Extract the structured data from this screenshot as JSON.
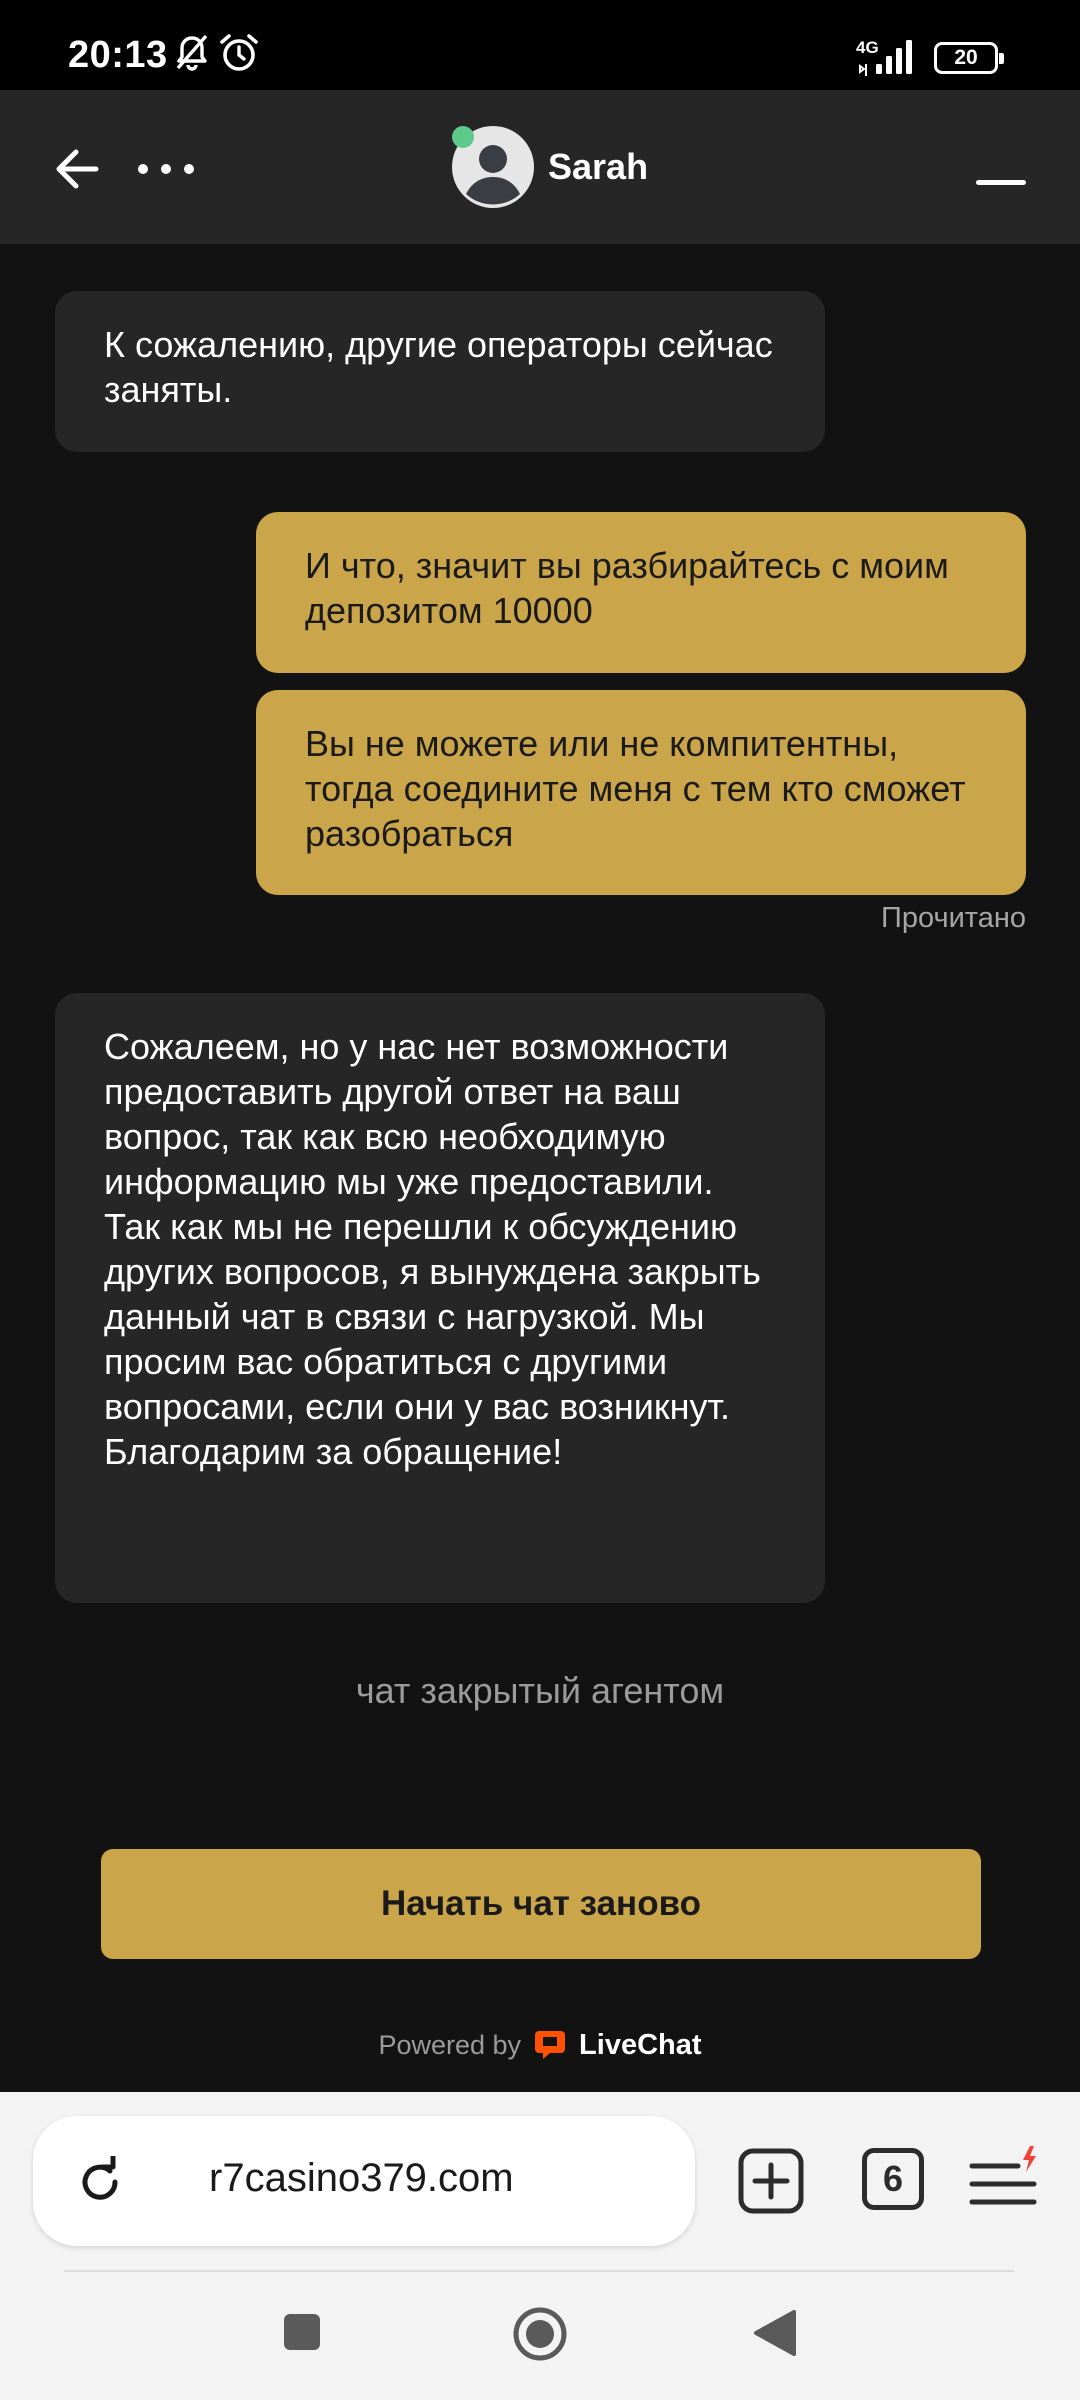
{
  "status_bar": {
    "time": "20:13",
    "network": "4G",
    "battery": "20",
    "icons": [
      "bell-off-icon",
      "alarm-icon",
      "signal-icon",
      "battery-icon"
    ]
  },
  "header": {
    "agent_name": "Sarah",
    "online": true,
    "icons": [
      "back-arrow-icon",
      "more-dots-icon",
      "avatar-icon",
      "minimize-icon"
    ]
  },
  "messages": [
    {
      "from": "agent",
      "text": "К сожалению, другие операторы сейчас заняты."
    },
    {
      "from": "user",
      "text": "И что, значит вы разбирайтесь с моим депозитом 10000"
    },
    {
      "from": "user",
      "text": "Вы не можете или не компитентны, тогда соедините меня с тем кто сможет разобраться"
    },
    {
      "from": "agent",
      "text": "Сожалеем, но у нас нет возможности предоставить другой ответ на ваш вопрос, так как всю необходимую информацию мы уже предоставили. Так как мы не перешли к обсуждению других вопросов, я вынуждена закрыть данный чат в связи с нагрузкой. Мы просим вас обратиться с другими вопросами, если они у вас возникнут. Благодарим за обращение!"
    }
  ],
  "read_status": "Прочитано",
  "closed_note": "чат закрытый агентом",
  "restart_button": "Начать чат заново",
  "powered_by": {
    "prefix": "Powered by",
    "brand": "LiveChat"
  },
  "browser": {
    "url": "r7casino379.com",
    "tab_count": "6",
    "icons": [
      "reload-icon",
      "new-tab-icon",
      "tabs-icon",
      "menu-icon"
    ]
  },
  "colors": {
    "accent": "#caa54a",
    "background": "#121212",
    "agent_bubble": "#262626",
    "online": "#5dc98a",
    "livechat": "#ff5100"
  }
}
